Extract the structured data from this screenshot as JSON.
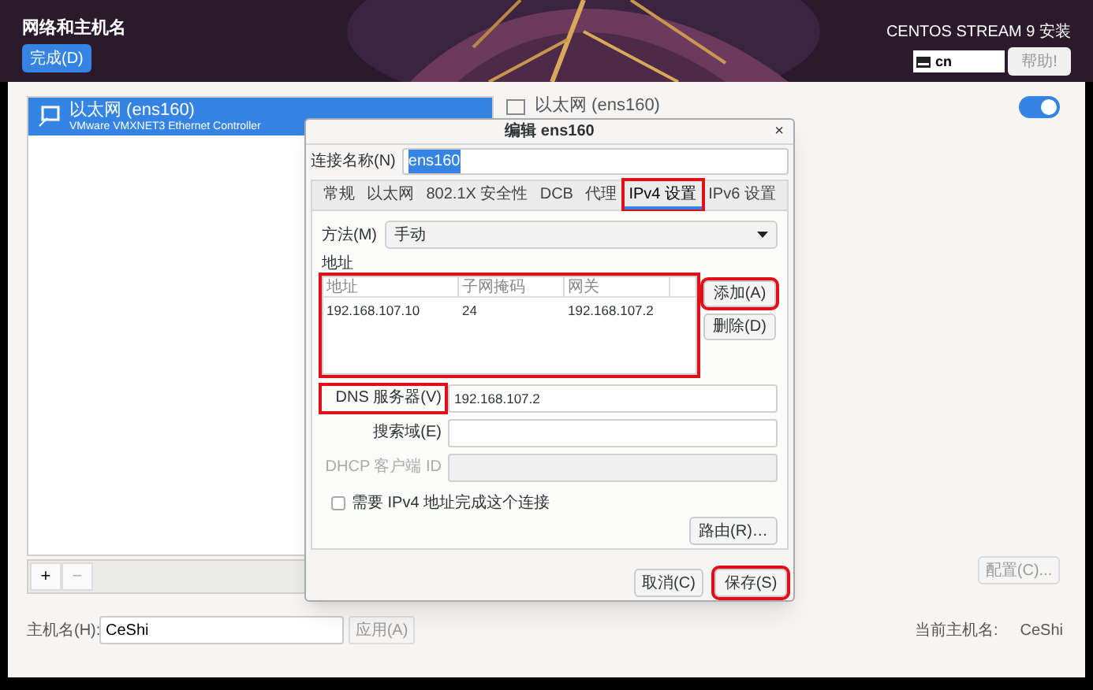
{
  "header": {
    "title": "网络和主机名",
    "done_button": "完成(D)",
    "product": "CENTOS STREAM 9 安装",
    "keyboard": "cn",
    "help_button": "帮助!"
  },
  "devices": [
    {
      "name": "以太网 (ens160)",
      "description": "VMware VMXNET3 Ethernet Controller",
      "selected": true
    }
  ],
  "list_buttons": [
    {
      "label": "+",
      "disabled": false
    },
    {
      "label": "−",
      "disabled": true
    }
  ],
  "device_detail": {
    "title": "以太网 (ens160)",
    "on": true
  },
  "configure_button": {
    "label": "配置(C)...",
    "disabled": true
  },
  "hostname": {
    "label": "主机名(H):",
    "value": "CeShi",
    "apply_button": "应用(A)",
    "current_label": "当前主机名:",
    "current_value": "CeShi"
  },
  "dialog": {
    "title": "编辑 ens160",
    "close": "×",
    "name_label": "连接名称(N)",
    "name_value": "ens160",
    "tabs": [
      {
        "label": "常规",
        "selected": false,
        "highlighted": false
      },
      {
        "label": "以太网",
        "selected": false,
        "highlighted": false
      },
      {
        "label": "802.1X 安全性",
        "selected": false,
        "highlighted": false
      },
      {
        "label": "DCB",
        "selected": false,
        "highlighted": false
      },
      {
        "label": "代理",
        "selected": false,
        "highlighted": false
      },
      {
        "label": "IPv4 设置",
        "selected": true,
        "highlighted": true
      },
      {
        "label": "IPv6 设置",
        "selected": false,
        "highlighted": false
      }
    ],
    "method_label": "方法(M)",
    "method_value": "手动",
    "address_label": "地址",
    "address_table": {
      "highlighted": true,
      "columns": [
        "地址",
        "子网掩码",
        "网关"
      ],
      "rows": [
        [
          "192.168.107.10",
          "24",
          "192.168.107.2"
        ]
      ]
    },
    "add_button": {
      "label": "添加(A)",
      "highlighted": true
    },
    "delete_button": {
      "label": "删除(D)",
      "highlighted": false
    },
    "fields": [
      {
        "label": "DNS 服务器(V)",
        "value": "192.168.107.2",
        "disabled": false,
        "highlighted": true
      },
      {
        "label": "搜索域(E)",
        "disabled": false,
        "highlighted": false
      },
      {
        "label": "DHCP 客户端 ID",
        "disabled": true,
        "highlighted": false
      }
    ],
    "require_checkbox": {
      "label": "需要 IPv4 地址完成这个连接",
      "checked": false
    },
    "routes_button": "路由(R)…",
    "cancel_button": {
      "label": "取消(C)",
      "highlighted": false
    },
    "save_button": {
      "label": "保存(S)",
      "highlighted": true
    }
  }
}
